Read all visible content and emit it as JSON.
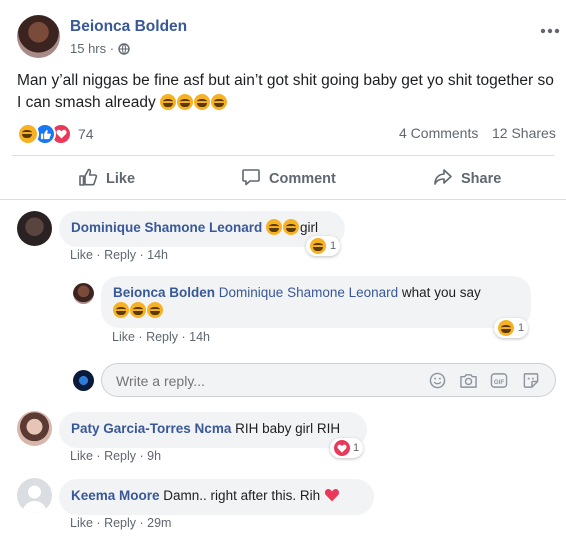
{
  "post": {
    "author": "Beionca Bolden",
    "time": "15 hrs",
    "privacy_icon": "globe-icon",
    "text": "Man y’all niggas be fine asf but ain’t got shit going baby get yo shit together so I can smash already",
    "reaction_count": "74",
    "comments_count": "4 Comments",
    "shares_count": "12 Shares",
    "colors": {
      "link": "#385898",
      "meta": "#606770",
      "love": "#e9385a",
      "like": "#1877f2",
      "haha": "#f7b125"
    }
  },
  "actions": {
    "like": "Like",
    "comment": "Comment",
    "share": "Share"
  },
  "comments": [
    {
      "author": "Dominique Shamone Leonard",
      "text": "girl",
      "reaction_count": "1",
      "like": "Like",
      "reply": "Reply",
      "time": "14h"
    },
    {
      "author": "Beionca Bolden",
      "mention": "Dominique Shamone Leonard",
      "text": "what you say",
      "reaction_count": "1",
      "like": "Like",
      "reply": "Reply",
      "time": "14h"
    },
    {
      "author": "Paty Garcia-Torres Ncma",
      "text": "RIH baby girl RIH",
      "reaction_count": "1",
      "like": "Like",
      "reply": "Reply",
      "time": "9h"
    },
    {
      "author": "Keema Moore",
      "text": "Damn.. right after this. Rih",
      "like": "Like",
      "reply": "Reply",
      "time": "29m"
    }
  ],
  "reply_box": {
    "placeholder": "Write a reply..."
  }
}
